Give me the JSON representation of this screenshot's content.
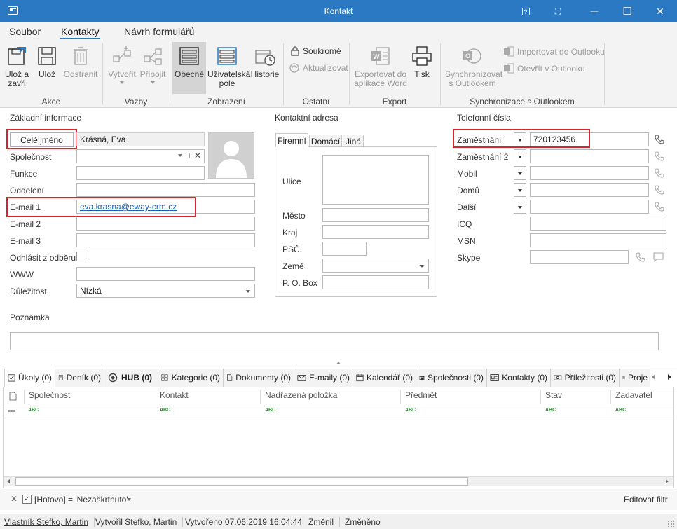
{
  "window": {
    "title": "Kontakt",
    "controls": [
      "?",
      "⛶",
      "—",
      "☐",
      "✕"
    ]
  },
  "menu": [
    "Soubor",
    "Kontakty",
    "Návrh formulářů"
  ],
  "ribbon": {
    "akce": {
      "group": "Akce",
      "save_close": "Ulož a zavři",
      "save": "Ulož",
      "delete": "Odstranit"
    },
    "vazby": {
      "group": "Vazby",
      "create": "Vytvořit",
      "attach": "Připojit"
    },
    "zobrazeni": {
      "group": "Zobrazení",
      "general": "Obecné",
      "user_fields": "Uživatelská pole",
      "history": "Historie"
    },
    "ostatni": {
      "group": "Ostatní",
      "private": "Soukromé",
      "refresh": "Aktualizovat"
    },
    "export": {
      "group": "Export",
      "word": "Exportovat do aplikace Word",
      "print": "Tisk"
    },
    "outlook": {
      "group": "Synchronizace s Outlookem",
      "sync": "Synchronizovat s Outlookem",
      "import": "Importovat do Outlooku",
      "open": "Otevřít v Outlooku"
    }
  },
  "basic": {
    "section": "Základní informace",
    "fullname_button": "Celé jméno",
    "fullname_value": "Krásná, Eva",
    "company_label": "Společnost",
    "function_label": "Funkce",
    "department_label": "Oddělení",
    "email1_label": "E-mail 1",
    "email1_value": "eva.krasna@eway-crm.cz",
    "email2_label": "E-mail 2",
    "email3_label": "E-mail 3",
    "unsubscribe_label": "Odhlásit z odběru",
    "www_label": "WWW",
    "importance_label": "Důležitost",
    "importance_value": "Nízká"
  },
  "address": {
    "section": "Kontaktní adresa",
    "tabs": [
      "Firemní",
      "Domácí",
      "Jiná"
    ],
    "street_label": "Ulice",
    "city_label": "Město",
    "region_label": "Kraj",
    "zip_label": "PSČ",
    "country_label": "Země",
    "pobox_label": "P. O. Box"
  },
  "phones": {
    "section": "Telefonní čísla",
    "rows": [
      {
        "label": "Zaměstnání",
        "value": "720123456"
      },
      {
        "label": "Zaměstnání 2",
        "value": ""
      },
      {
        "label": "Mobil",
        "value": ""
      },
      {
        "label": "Domů",
        "value": ""
      },
      {
        "label": "Další",
        "value": ""
      }
    ],
    "icq_label": "ICQ",
    "msn_label": "MSN",
    "skype_label": "Skype"
  },
  "note": {
    "label": "Poznámka"
  },
  "relation_tabs": [
    "Úkoly (0)",
    "Deník (0)",
    "HUB (0)",
    "Kategorie (0)",
    "Dokumenty (0)",
    "E-maily (0)",
    "Kalendář (0)",
    "Společnosti (0)",
    "Kontakty (0)",
    "Příležitosti (0)",
    "Proje"
  ],
  "grid": {
    "columns": [
      "Společnost",
      "Kontakt",
      "Nadřazená položka",
      "Předmět",
      "Stav",
      "Zadavatel"
    ],
    "filter_placeholder": "ABC"
  },
  "filter": {
    "text": "[Hotovo] = 'Nezaškrtnuto'",
    "edit": "Editovat filtr"
  },
  "status": {
    "owner": "Vlastník Stefko, Martin",
    "created_by": "Vytvořil Stefko, Martin",
    "created_on": "Vytvořeno 07.06.2019 16:04:44",
    "modified": "Změnil",
    "changed": "Změněno"
  },
  "colors": {
    "titlebar": "#2b79c2",
    "highlight": "#d9232e",
    "link": "#1a5fb4"
  }
}
